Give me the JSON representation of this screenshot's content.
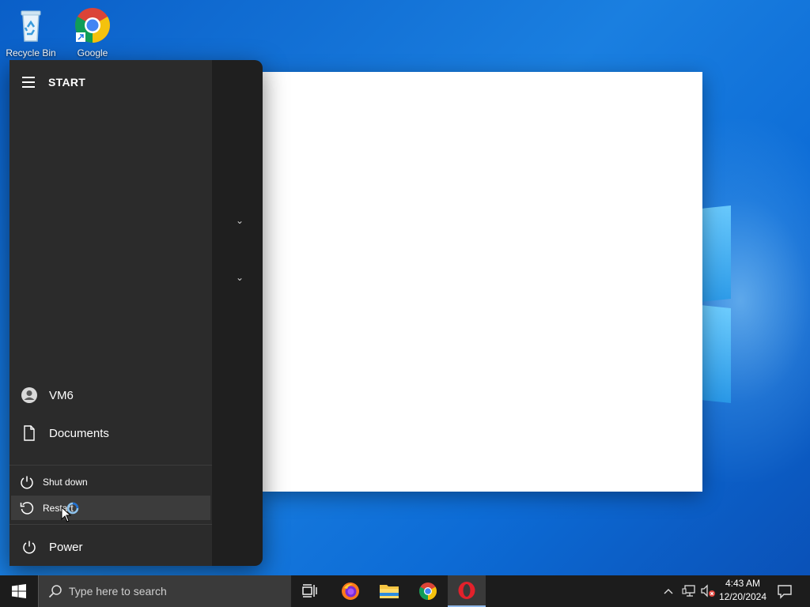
{
  "desktop": {
    "icons": [
      {
        "label": "Recycle Bin",
        "icon": "recycle-bin-icon"
      },
      {
        "label": "Google",
        "icon": "chrome-icon"
      }
    ]
  },
  "start_menu": {
    "title": "START",
    "user": "VM6",
    "documents": "Documents",
    "power_options": {
      "shutdown": "Shut down",
      "restart": "Restart"
    },
    "power": "Power"
  },
  "taskbar": {
    "search_placeholder": "Type here to search",
    "apps": [
      "task-view",
      "firefox",
      "file-explorer",
      "chrome",
      "opera"
    ],
    "time": "4:43 AM",
    "date": "12/20/2024"
  },
  "colors": {
    "desktop_blue": "#0a5fc8",
    "menu_dark": "#1f1f1f",
    "menu_panel": "#2b2b2b",
    "taskbar": "#1c1c1c"
  }
}
